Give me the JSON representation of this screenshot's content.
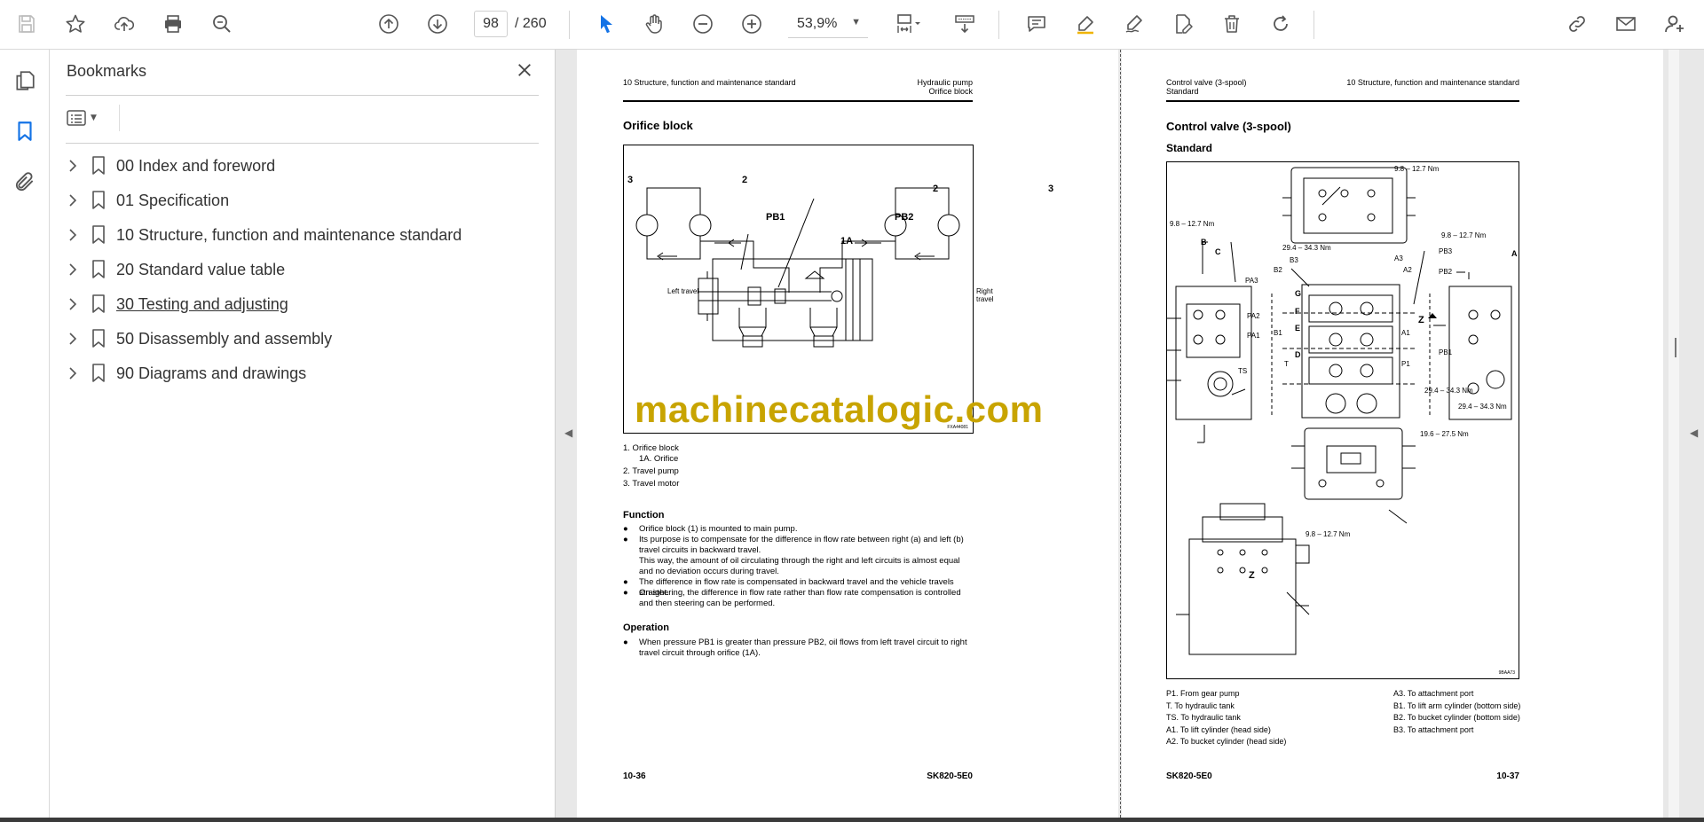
{
  "toolbar": {
    "current_page": "98",
    "page_total": "/  260",
    "zoom": "53,9%"
  },
  "bookmarks": {
    "title": "Bookmarks",
    "items": [
      {
        "label": "00 Index and foreword"
      },
      {
        "label": "01 Specification"
      },
      {
        "label": "10 Structure, function and maintenance standard"
      },
      {
        "label": "20 Standard value table"
      },
      {
        "label": "30 Testing and adjusting"
      },
      {
        "label": "50 Disassembly and assembly"
      },
      {
        "label": "90 Diagrams and drawings"
      }
    ]
  },
  "left_page": {
    "header_left": "10 Structure, function and maintenance standard",
    "header_right_1": "Hydraulic pump",
    "header_right_2": "Orifice block",
    "section_title": "Orifice block",
    "figure": {
      "label_3_left": "3",
      "label_2_left": "2",
      "label_pb1": "PB1",
      "label_1a": "1A",
      "label_pb2": "PB2",
      "label_2_right": "2",
      "label_3_right": "3",
      "left_travel": "Left travel",
      "right_travel": "Right travel",
      "fig_code": "FXA44081"
    },
    "legend": [
      "1.    Orifice block",
      "1A. Orifice",
      "2.    Travel pump",
      "3.    Travel motor"
    ],
    "function_title": "Function",
    "function_bullets": [
      "Orifice block (1) is mounted to main pump.",
      "Its purpose is to compensate for the difference in flow rate between right (a) and left (b) travel circuits in backward travel.",
      "This way, the amount of oil circulating through the right and left circuits is almost equal and no deviation occurs during travel.",
      "The difference in flow rate is compensated in backward travel and the vehicle travels straight.",
      "On steering, the difference in flow rate rather than flow rate compensation is controlled and then steering can be performed."
    ],
    "operation_title": "Operation",
    "operation_bullet": "When pressure PB1 is greater than pressure PB2, oil flows from left travel circuit to right travel circuit through orifice (1A).",
    "footer_left": "10-36",
    "footer_right": "SK820-5E0"
  },
  "right_page": {
    "header_left_1": "Control valve (3-spool)",
    "header_left_2": "Standard",
    "header_right": "10 Structure, function and maintenance standard",
    "section_title": "Control valve (3-spool)",
    "subsection_title": "Standard",
    "figure": {
      "torque_top": "9.8 – 12.7 Nm",
      "torque_left": "9.8 – 12.7 Nm",
      "torque_mid": "29.4 – 34.3 Nm",
      "torque_right": "9.8 – 12.7 Nm",
      "torque_right_low1": "29.4 – 34.3 Nm",
      "torque_right_low2": "29.4 – 34.3 Nm",
      "torque_bottom": "19.6 – 27.5 Nm",
      "torque_lowest": "9.8 – 12.7 Nm",
      "ports_left": [
        "PA3",
        "PA2",
        "PA1",
        "TS"
      ],
      "ports_mid_left": [
        "B3",
        "B2",
        "B1",
        "T"
      ],
      "ports_mid_right": [
        "A3",
        "A2",
        "A1",
        "P1"
      ],
      "ports_right": [
        "PB3",
        "PB2",
        "PB1"
      ],
      "section_letters": [
        "B",
        "C",
        "G",
        "F",
        "E",
        "D",
        "A",
        "Z"
      ],
      "fig_code": "9BAA73"
    },
    "legend_left": [
      "P1.  From gear pump",
      "T.    To hydraulic tank",
      "TS.  To hydraulic tank",
      "A1.  To lift cylinder (head side)",
      "A2.  To bucket cylinder (head side)"
    ],
    "legend_right": [
      "A3.  To attachment port",
      "B1.  To lift arm cylinder (bottom side)",
      "B2.  To bucket cylinder (bottom side)",
      "B3.  To attachment port"
    ],
    "footer_left": "SK820-5E0",
    "footer_right": "10-37"
  },
  "watermark": "machinecatalogic.com"
}
